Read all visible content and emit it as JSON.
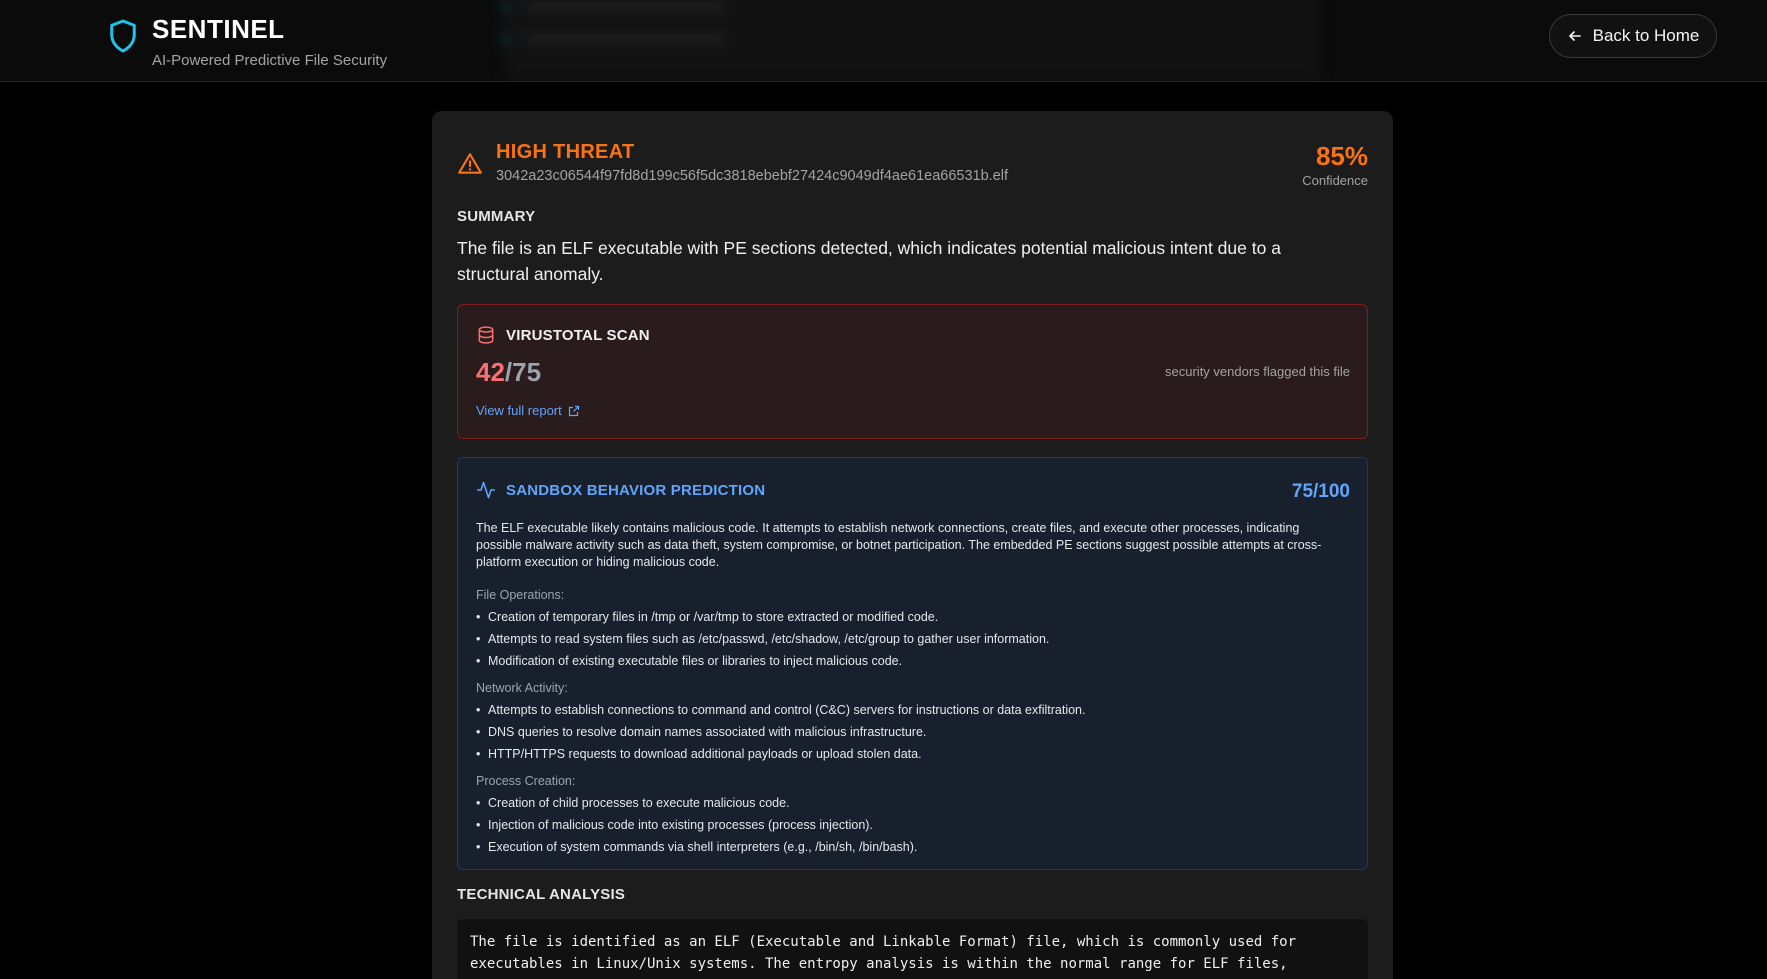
{
  "header": {
    "title": "SENTINEL",
    "subtitle": "AI-Powered Predictive File Security",
    "back_label": "Back to Home",
    "brand_icon": "shield-icon",
    "accent_color": "#22c3e6"
  },
  "threat": {
    "level": "HIGH THREAT",
    "filename": "3042a23c06544f97fd8d199c56f5dc3818ebebf27424c9049df4ae61ea66531b.elf",
    "confidence_value": "85%",
    "confidence_label": "Confidence",
    "color": "#f97316"
  },
  "summary": {
    "label": "SUMMARY",
    "text": "The file is an ELF executable with PE sections detected, which indicates potential malicious intent due to a structural anomaly."
  },
  "virustotal": {
    "title": "VIRUSTOTAL SCAN",
    "flagged": "42",
    "total": "/75",
    "note": "security vendors flagged this file",
    "link": "View full report",
    "icon": "database-icon"
  },
  "sandbox": {
    "title": "SANDBOX BEHAVIOR PREDICTION",
    "score": "75/100",
    "icon": "activity-icon",
    "description": "The ELF executable likely contains malicious code. It attempts to establish network connections, create files, and execute other processes, indicating possible malware activity such as data theft, system compromise, or botnet participation. The embedded PE sections suggest possible attempts at cross-platform execution or hiding malicious code.",
    "categories": [
      {
        "title": "File Operations:",
        "items": [
          "Creation of temporary files in /tmp or /var/tmp to store extracted or modified code.",
          "Attempts to read system files such as /etc/passwd, /etc/shadow, /etc/group to gather user information.",
          "Modification of existing executable files or libraries to inject malicious code."
        ]
      },
      {
        "title": "Network Activity:",
        "items": [
          "Attempts to establish connections to command and control (C&C) servers for instructions or data exfiltration.",
          "DNS queries to resolve domain names associated with malicious infrastructure.",
          "HTTP/HTTPS requests to download additional payloads or upload stolen data."
        ]
      },
      {
        "title": "Process Creation:",
        "items": [
          "Creation of child processes to execute malicious code.",
          "Injection of malicious code into existing processes (process injection).",
          "Execution of system commands via shell interpreters (e.g., /bin/sh, /bin/bash)."
        ]
      }
    ]
  },
  "technical": {
    "label": "TECHNICAL ANALYSIS",
    "text": "The file is identified as an ELF (Executable and Linkable Format) file, which is commonly used for executables in Linux/Unix systems. The entropy analysis is within the normal range for ELF files,"
  }
}
